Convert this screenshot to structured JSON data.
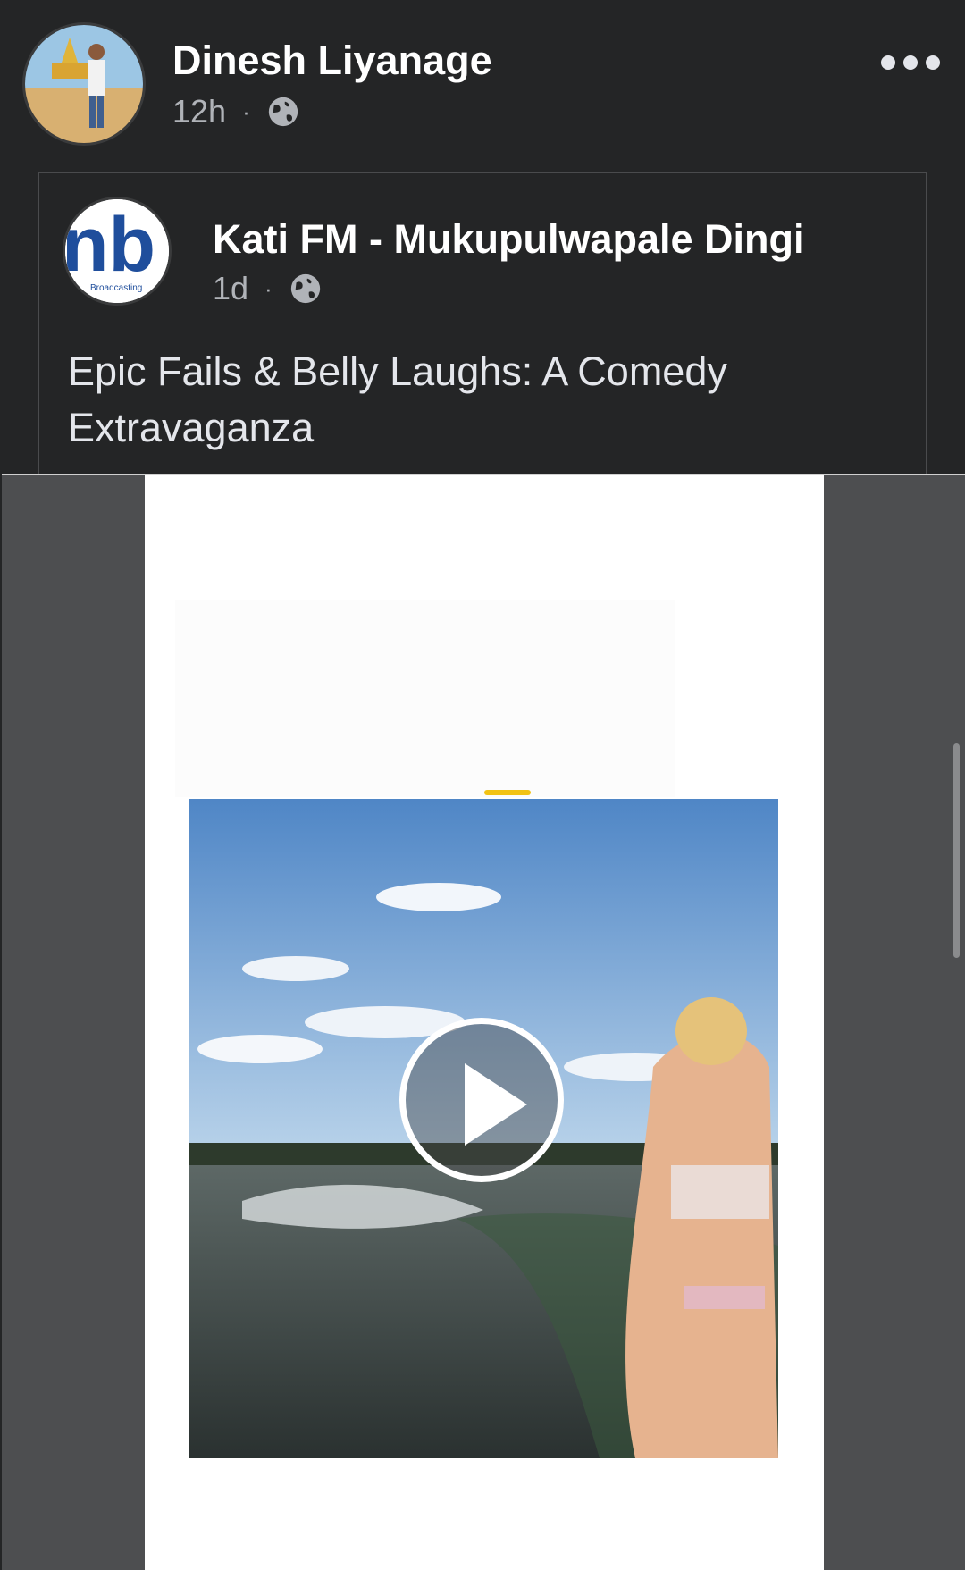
{
  "post": {
    "author_name": "Dinesh Liyanage",
    "time": "12h",
    "separator": "·",
    "privacy_icon": "globe-icon",
    "more_icon": "more-options-icon"
  },
  "shared": {
    "page_name": "Kati FM - Mukupulwapale Dingi",
    "time": "1d",
    "separator": "·",
    "privacy_icon": "globe-icon",
    "logo_text": "nb",
    "logo_subtext": "Broadcasting",
    "text": "Epic Fails & Belly Laughs: A Comedy Extravaganza"
  },
  "media": {
    "type": "video",
    "play_icon": "play-icon"
  },
  "colors": {
    "background": "#242526",
    "text_primary": "#ffffff",
    "text_secondary": "#b0b3b8",
    "media_side": "#4d4e50",
    "logo_blue": "#1f4e9c"
  }
}
